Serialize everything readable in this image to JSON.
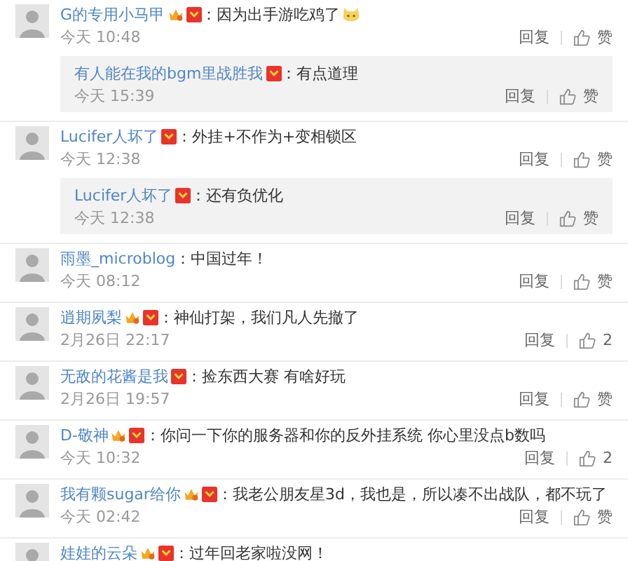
{
  "comments": [
    {
      "name": "G的专用小马甲",
      "vip": true,
      "medal": true,
      "text": "：因为出手游吃鸡了",
      "emoji": true,
      "time": "今天 10:48",
      "reply": "回复",
      "like": "赞",
      "replies": [
        {
          "name": "有人能在我的bgm里战胜我",
          "vip": false,
          "medal": true,
          "text": "：有点道理",
          "time": "今天 15:39",
          "reply": "回复",
          "like": "赞"
        }
      ]
    },
    {
      "name": "Lucifer人坏了",
      "vip": false,
      "medal": true,
      "text": "：外挂+不作为+变相锁区",
      "emoji": false,
      "time": "今天 12:38",
      "reply": "回复",
      "like": "赞",
      "replies": [
        {
          "name": "Lucifer人坏了",
          "vip": false,
          "medal": true,
          "text": "：还有负优化",
          "time": "今天 12:38",
          "reply": "回复",
          "like": "赞"
        }
      ]
    },
    {
      "name": "雨墨_microblog",
      "vip": false,
      "medal": false,
      "text": "：中国过年！",
      "emoji": false,
      "time": "今天 08:12",
      "reply": "回复",
      "like": "赞"
    },
    {
      "name": "逍期夙梨",
      "vip": true,
      "medal": true,
      "text": "：神仙打架，我们凡人先撤了",
      "emoji": false,
      "time": "2月26日 22:17",
      "reply": "回复",
      "like": "2"
    },
    {
      "name": "无敌的花酱是我",
      "vip": false,
      "medal": true,
      "text": "：捡东西大赛 有啥好玩",
      "emoji": false,
      "time": "2月26日 19:57",
      "reply": "回复",
      "like": "赞"
    },
    {
      "name": "D-敬神",
      "vip": true,
      "medal": true,
      "text": "：你问一下你的服务器和你的反外挂系统 你心里没点b数吗",
      "emoji": false,
      "time": "今天 10:32",
      "reply": "回复",
      "like": "2"
    },
    {
      "name": "我有颗sugar给你",
      "vip": true,
      "medal": true,
      "text": "：我老公朋友星3d，我也是，所以凑不出战队，都不玩了",
      "emoji": false,
      "time": "今天 02:42",
      "reply": "回复",
      "like": "赞"
    },
    {
      "name": "娃娃的云朵",
      "vip": true,
      "medal": true,
      "text": "：过年回老家啦没网！",
      "emoji": false
    }
  ]
}
